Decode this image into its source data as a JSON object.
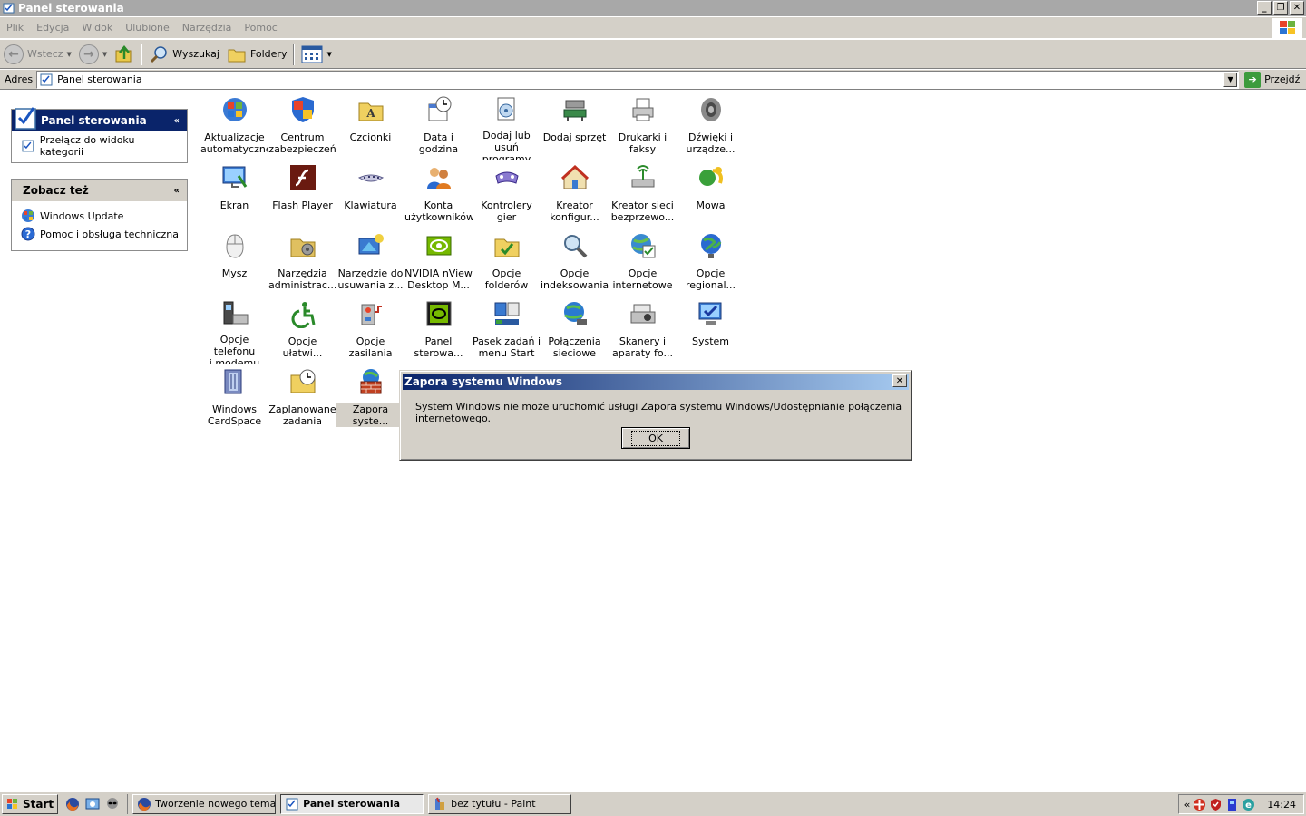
{
  "window": {
    "title": "Panel sterowania"
  },
  "menu": [
    "Plik",
    "Edycja",
    "Widok",
    "Ulubione",
    "Narzędzia",
    "Pomoc"
  ],
  "toolbar": {
    "back": "Wstecz",
    "search": "Wyszukaj",
    "folders": "Foldery"
  },
  "address": {
    "label": "Adres",
    "value": "Panel sterowania",
    "go": "Przejdź"
  },
  "sidebar": {
    "cp_title": "Panel sterowania",
    "switch_view": "Przełącz do widoku kategorii",
    "see_also_title": "Zobacz też",
    "windows_update": "Windows Update",
    "help": "Pomoc i obsługa techniczna"
  },
  "icons": [
    "Aktualizacje\nautomatyczne",
    "Centrum\nzabezpieczeń",
    "Czcionki",
    "Data i godzina",
    "Dodaj lub usuń\nprogramy",
    "Dodaj sprzęt",
    "Drukarki i\nfaksy",
    "Dźwięki i\nurządze...",
    "Ekran",
    "Flash Player",
    "Klawiatura",
    "Konta\nużytkowników",
    "Kontrolery gier",
    "Kreator\nkonfigur...",
    "Kreator sieci\nbezprzewo...",
    "Mowa",
    "Mysz",
    "Narzędzia\nadministrac...",
    "Narzędzie do\nusuwania z...",
    "NVIDIA nView\nDesktop M...",
    "Opcje\nfolderów",
    "Opcje\nindeksowania",
    "Opcje\ninternetowe",
    "Opcje\nregional...",
    "Opcje telefonu\ni modemu",
    "Opcje\nułatwi...",
    "Opcje zasilania",
    "Panel\nsterowa...",
    "Pasek zadań i\nmenu Start",
    "Połączenia\nsieciowe",
    "Skanery i\naparaty fo...",
    "System",
    "Windows\nCardSpace",
    "Zaplanowane\nzadania",
    "Zapora\nsyste..."
  ],
  "dialog": {
    "title": "Zapora systemu Windows",
    "message": "System Windows nie może uruchomić usługi Zapora systemu Windows/Udostępnianie połączenia internetowego.",
    "ok": "OK"
  },
  "taskbar": {
    "start": "Start",
    "tasks": [
      "Tworzenie nowego tema...",
      "Panel sterowania",
      "bez tytułu - Paint"
    ],
    "tray_chevron": "«",
    "clock": "14:24"
  }
}
